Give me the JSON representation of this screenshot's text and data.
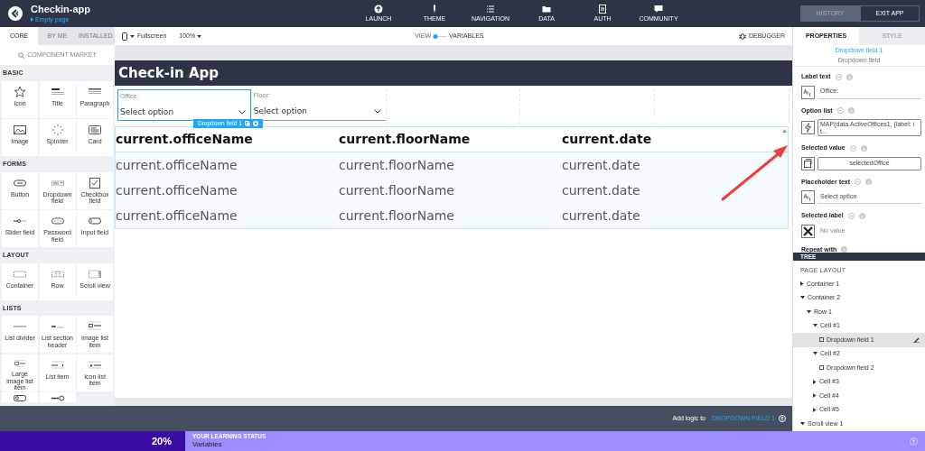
{
  "app": {
    "title": "Checkin-app",
    "page": "Empty page"
  },
  "nav": [
    {
      "label": "LAUNCH"
    },
    {
      "label": "THEME"
    },
    {
      "label": "NAVIGATION"
    },
    {
      "label": "DATA"
    },
    {
      "label": "AUTH"
    },
    {
      "label": "COMMUNITY"
    }
  ],
  "top_buttons": [
    {
      "label": "HISTORY",
      "selected": true
    },
    {
      "label": "EXIT APP",
      "selected": false
    }
  ],
  "left_tabs": [
    {
      "label": "CORE",
      "selected": true
    },
    {
      "label": "BY ME",
      "selected": false
    },
    {
      "label": "INSTALLED",
      "selected": false
    }
  ],
  "component_market": "COMPONENT MARKET",
  "sections": [
    {
      "title": "BASIC",
      "items": [
        "Icon",
        "Title",
        "Paragraph",
        "Image",
        "Spinner",
        "Card"
      ]
    },
    {
      "title": "FORMS",
      "items": [
        "Button",
        "Dropdown field",
        "Checkbox field",
        "Slider field",
        "Password field",
        "Input field"
      ]
    },
    {
      "title": "LAYOUT",
      "items": [
        "Container",
        "Row",
        "Scroll view"
      ]
    },
    {
      "title": "LISTS",
      "items": [
        "List divider",
        "List section header",
        "Image list item",
        "Large image list item",
        "List item",
        "Icon list item"
      ],
      "cut_off_tiles": [
        {
          "kind": "search"
        },
        {
          "kind": "toggle"
        }
      ]
    }
  ],
  "toolbar": {
    "device": "Fullscreen",
    "zoom": "100%",
    "view": "VIEW",
    "variables": "VARIABLES",
    "debugger": "DEBUGGER"
  },
  "canvas": {
    "app_title": "Check-in App",
    "dropdowns": [
      {
        "label": "Office:",
        "placeholder": "Select option",
        "selected": true
      },
      {
        "label": "Floor:",
        "placeholder": "Select option",
        "selected": false
      }
    ],
    "selection_tag": "Dropdown field 1",
    "header_row": [
      "current.officeName",
      "current.floorName",
      "current.date"
    ],
    "rows": [
      [
        "current.officeName",
        "current.floorName",
        "current.date"
      ],
      [
        "current.officeName",
        "current.floorName",
        "current.date"
      ],
      [
        "current.officeName",
        "current.floorName",
        "current.date"
      ]
    ]
  },
  "right_tabs": [
    {
      "label": "PROPERTIES",
      "selected": true
    },
    {
      "label": "STYLE",
      "selected": false
    }
  ],
  "component": {
    "name": "Dropdown field 1",
    "type": "Dropdown field"
  },
  "properties": [
    {
      "label": "Label text",
      "kind": "text",
      "value": "Office:"
    },
    {
      "label": "Option list",
      "kind": "formula",
      "value": "MAP(data.ActiveOffices1, {label: it..."
    },
    {
      "label": "Selected value",
      "kind": "binding",
      "value": "selectedOffice"
    },
    {
      "label": "Placeholder text",
      "kind": "text",
      "value": "Select option"
    },
    {
      "label": "Selected label",
      "kind": "none",
      "value": "No value"
    },
    {
      "label": "Repeat with",
      "kind": "empty"
    }
  ],
  "tree": {
    "title": "TREE",
    "heading": "PAGE LAYOUT",
    "items": [
      {
        "label": "Container 1",
        "expanded": false,
        "selected": false
      },
      {
        "label": "Container 2",
        "expanded": true,
        "selected": false,
        "children": [
          {
            "label": "Row 1",
            "expanded": true,
            "selected": false,
            "children": [
              {
                "label": "Cell #1",
                "expanded": true,
                "selected": false,
                "children": [
                  {
                    "label": "Dropdown field 1",
                    "kind": "leaf",
                    "selected": true
                  }
                ]
              },
              {
                "label": "Cell #2",
                "expanded": true,
                "selected": false,
                "children": [
                  {
                    "label": "Dropdown field 2",
                    "kind": "leaf",
                    "selected": false
                  }
                ]
              },
              {
                "label": "Cell #3",
                "expanded": false,
                "selected": false
              },
              {
                "label": "Cell #4",
                "expanded": false,
                "selected": false
              },
              {
                "label": "Cell #5",
                "expanded": false,
                "selected": false
              }
            ]
          }
        ]
      },
      {
        "label": "Scroll view 1",
        "expanded": true,
        "selected": false
      }
    ]
  },
  "logic_bar": {
    "prefix": "Add logic to",
    "target": "DROPDOWN FIELD 1"
  },
  "learning": {
    "percent": "20%",
    "caption": "YOUR LEARNING STATUS",
    "topic": "Variables"
  }
}
